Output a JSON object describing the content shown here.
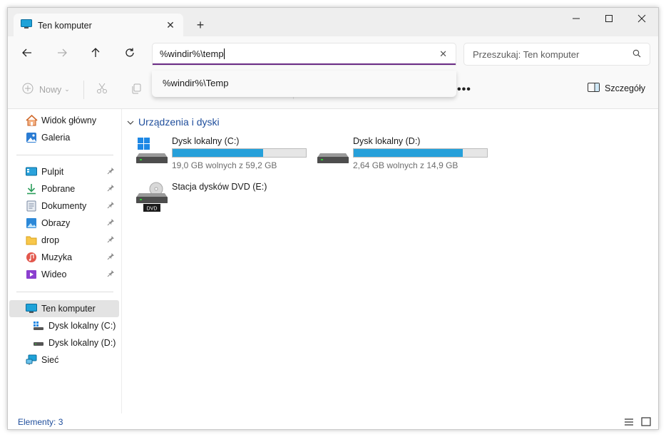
{
  "window": {
    "minimize_symbol": "—",
    "maximize_symbol": "☐",
    "close_symbol": "✕"
  },
  "tab": {
    "title": "Ten komputer",
    "close": "✕",
    "new_tab": "+"
  },
  "nav": {
    "back_icon": "arrow-left-icon",
    "forward_icon": "arrow-right-icon",
    "up_icon": "arrow-up-icon",
    "refresh_icon": "refresh-icon"
  },
  "address": {
    "value": "%windir%\\temp",
    "clear": "✕",
    "suggestion": "%windir%\\Temp"
  },
  "search": {
    "placeholder": "Przeszukaj: Ten komputer"
  },
  "toolbar": {
    "new_label": "Nowy",
    "more": "•••",
    "details_label": "Szczegóły"
  },
  "sidebar": {
    "items": [
      {
        "label": "Widok główny",
        "icon": "home-icon"
      },
      {
        "label": "Galeria",
        "icon": "gallery-icon"
      },
      {
        "label": "Pulpit",
        "icon": "desktop-icon",
        "pinned": true
      },
      {
        "label": "Pobrane",
        "icon": "download-icon",
        "pinned": true
      },
      {
        "label": "Dokumenty",
        "icon": "documents-icon",
        "pinned": true
      },
      {
        "label": "Obrazy",
        "icon": "pictures-icon",
        "pinned": true
      },
      {
        "label": "drop",
        "icon": "folder-icon",
        "pinned": true
      },
      {
        "label": "Muzyka",
        "icon": "music-icon",
        "pinned": true
      },
      {
        "label": "Wideo",
        "icon": "video-icon",
        "pinned": true
      },
      {
        "label": "Ten komputer",
        "icon": "computer-icon",
        "selected": true
      },
      {
        "label": "Dysk lokalny (C:)",
        "icon": "drive-icon"
      },
      {
        "label": "Dysk lokalny (D:)",
        "icon": "drive-icon"
      },
      {
        "label": "Sieć",
        "icon": "network-icon"
      }
    ]
  },
  "main": {
    "group_title": "Urządzenia i dyski",
    "drives": [
      {
        "name": "Dysk lokalny (C:)",
        "free_text": "19,0 GB wolnych z 59,2 GB",
        "used_fraction": 0.68
      },
      {
        "name": "Dysk lokalny (D:)",
        "free_text": "2,64 GB wolnych z 14,9 GB",
        "used_fraction": 0.82
      },
      {
        "name": "Stacja dysków DVD (E:)",
        "badge": "DVD"
      }
    ]
  },
  "status": {
    "count": "Elementy: 3"
  },
  "colors": {
    "accent": "#6b2c86",
    "bar_fill": "#26a0da",
    "link": "#1f4e9c"
  }
}
